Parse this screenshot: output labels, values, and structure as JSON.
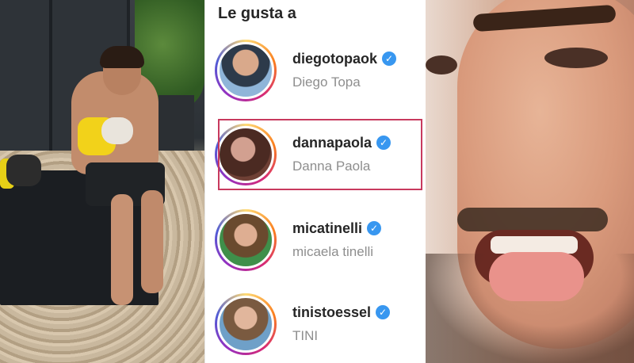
{
  "header": {
    "title": "Le gusta a"
  },
  "likes": [
    {
      "username": "diegotopaok",
      "fullname": "Diego Topa",
      "verified": true
    },
    {
      "username": "dannapaola",
      "fullname": "Danna Paola",
      "verified": true,
      "highlighted": true
    },
    {
      "username": "micatinelli",
      "fullname": "micaela tinelli",
      "verified": true
    },
    {
      "username": "tinistoessel",
      "fullname": "TINI",
      "verified": true
    }
  ],
  "icons": {
    "verified": "verified-badge-icon",
    "verified_glyph": "✓",
    "verified_color": "#3897f0",
    "highlight_color": "#c83a5e"
  }
}
